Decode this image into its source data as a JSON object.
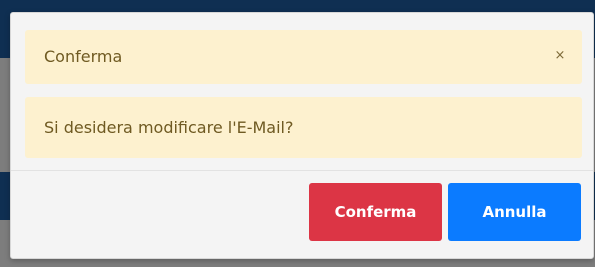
{
  "dialog": {
    "title": "Conferma",
    "close_label": "×",
    "message": "Si desidera modificare l'E-Mail?",
    "confirm_label": "Conferma",
    "cancel_label": "Annulla"
  },
  "colors": {
    "confirm_button": "#dc3545",
    "cancel_button": "#0b7bff",
    "alert_background": "#fdf1cf",
    "alert_text": "#6f5a22"
  }
}
